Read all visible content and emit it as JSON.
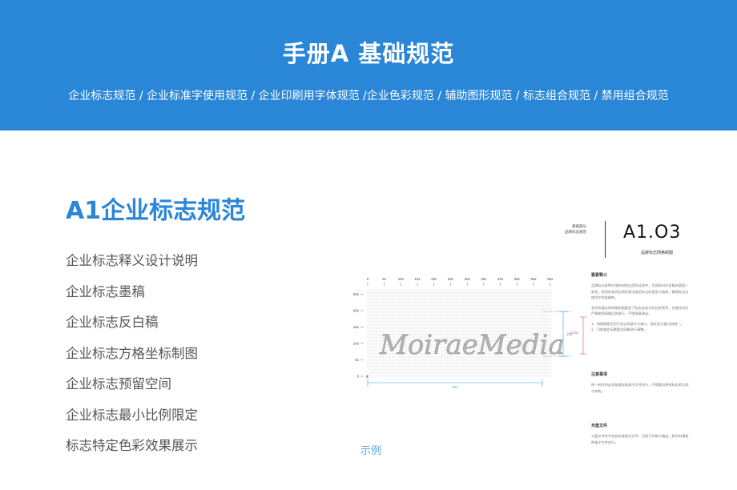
{
  "banner": {
    "title": "手册A 基础规范",
    "subtitle": "企业标志规范 / 企业标准字使用规范 / 企业印刷用字体规范 /企业色彩规范 / 辅助图形规范 / 标志组合规范 / 禁用组合规范"
  },
  "section": {
    "title": "A1企业标志规范",
    "items": [
      "企业标志释义设计说明",
      "企业标志墨稿",
      "企业标志反白稿",
      "企业标志方格坐标制图",
      "企业标志预留空间",
      "企业标志最小比例限定",
      "标志特定色彩效果展示"
    ],
    "example_label": "示例"
  },
  "doc_page": {
    "header_line1": "基础部分",
    "header_line2": "品牌标志规范",
    "code": "A1.O3",
    "subtitle": "品牌标志网格制图",
    "logo_text": "MoiraeMedia",
    "x_ticks": [
      "0",
      "5x",
      "10x",
      "15x",
      "20x",
      "25x",
      "30x",
      "35x",
      "40x",
      "45x",
      "50x",
      "55x"
    ],
    "y_ticks": [
      "25x",
      "20x",
      "15x",
      "10x",
      "5x",
      "0"
    ],
    "dim_width": "50x",
    "dim_height": "15x",
    "dim_height2": "13.5x",
    "origin_mark": "x",
    "col1_head": "要素释义",
    "col1_p1": "品牌标志各种环境和材质应用的过程中，为保持对外形象的高度一致性，采用标准的比例作图法规范标志的造型与结构，确保标志在使用中的准确性。",
    "col1_p2": "本页所展示的网格制图规定了标志各部分的比例关系，在制作时应严格按照网格比例进行，不得随意改动。",
    "col1_p3": "1、网格制图可用于标志的放大与缩小，保证各元素比例统一。2、可根据实际需要对网格进行调整。",
    "col2_head": "注意事项",
    "col2_p1": "统一制作时必须依据标准电子文件进行，不得擅自更改标志的比例与结构。",
    "col3_head": "光盘文件",
    "col3_p1": "光盘文件夹中含有标准格式文件，可用于印刷与输出，制作时请依照电子文件执行。"
  }
}
